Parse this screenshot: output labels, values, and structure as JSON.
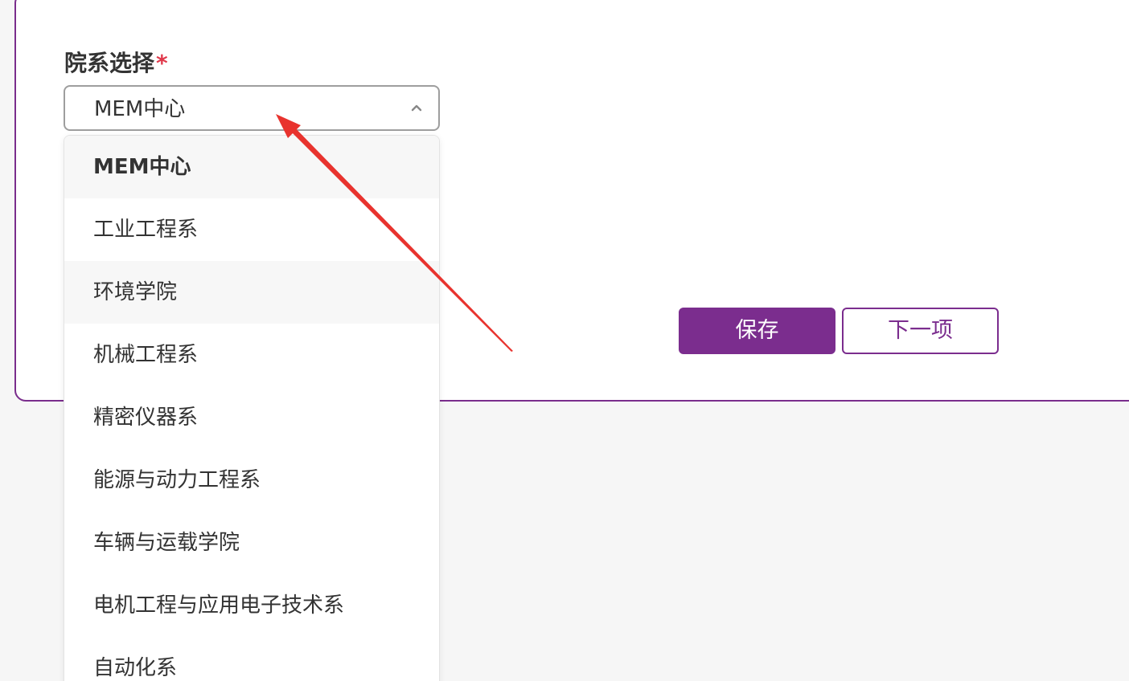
{
  "form": {
    "department_label": "院系选择",
    "required_mark": "*",
    "selected_value": "MEM中心"
  },
  "dropdown": {
    "options": [
      "MEM中心",
      "工业工程系",
      "环境学院",
      "机械工程系",
      "精密仪器系",
      "能源与动力工程系",
      "车辆与运载学院",
      "电机工程与应用电子技术系",
      "自动化系"
    ]
  },
  "buttons": {
    "save_label": "保存",
    "next_label": "下一项"
  },
  "colors": {
    "accent": "#7b2d8e",
    "required": "#e0384a",
    "annotation_arrow": "#e8332e"
  },
  "icons": {
    "select_toggle": "chevron-up-icon"
  }
}
